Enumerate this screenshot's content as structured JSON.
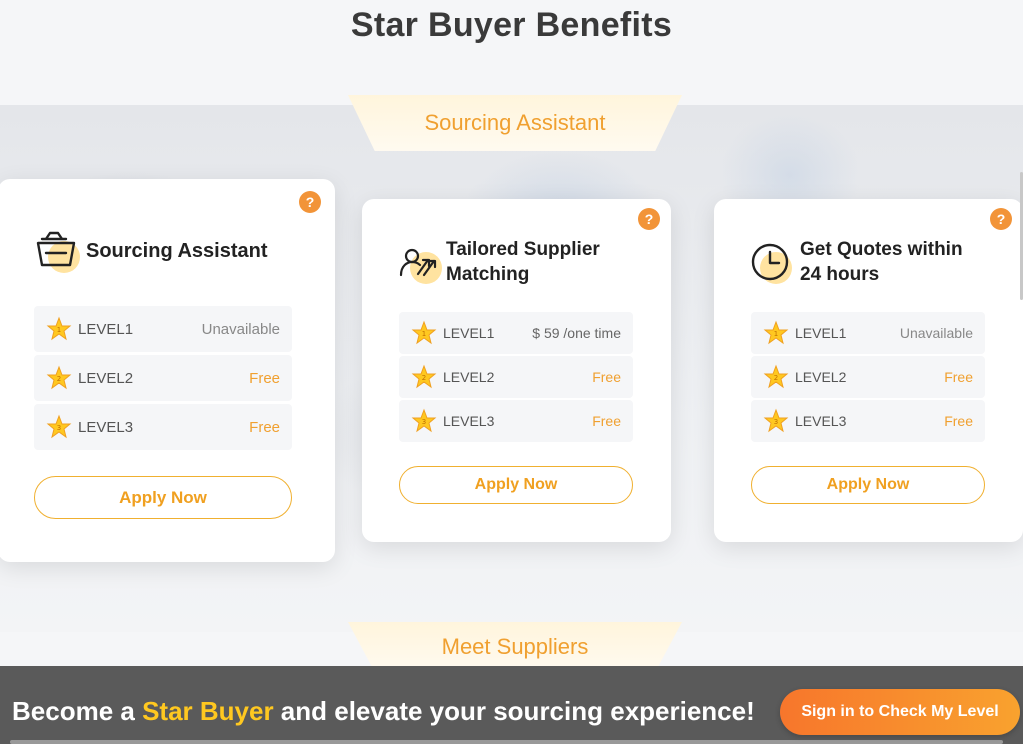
{
  "page": {
    "title": "Star Buyer Benefits"
  },
  "sections": {
    "top_label": "Sourcing Assistant",
    "bottom_label": "Meet Suppliers"
  },
  "cards": [
    {
      "title_line1": "Sourcing Assistant",
      "title_line2": "",
      "icon": "basket-icon",
      "help": "?",
      "levels": [
        {
          "name": "LEVEL1",
          "value": "Unavailable"
        },
        {
          "name": "LEVEL2",
          "value": "Free"
        },
        {
          "name": "LEVEL3",
          "value": "Free"
        }
      ],
      "button": "Apply Now"
    },
    {
      "title_line1": "Tailored Supplier",
      "title_line2": "Matching",
      "icon": "supplier-matching-icon",
      "help": "?",
      "levels": [
        {
          "name": "LEVEL1",
          "value": "$ 59 /one time"
        },
        {
          "name": "LEVEL2",
          "value": "Free"
        },
        {
          "name": "LEVEL3",
          "value": "Free"
        }
      ],
      "button": "Apply Now"
    },
    {
      "title_line1": "Get Quotes within",
      "title_line2": "24 hours",
      "icon": "clock-icon",
      "help": "?",
      "levels": [
        {
          "name": "LEVEL1",
          "value": "Unavailable"
        },
        {
          "name": "LEVEL2",
          "value": "Free"
        },
        {
          "name": "LEVEL3",
          "value": "Free"
        }
      ],
      "button": "Apply Now"
    }
  ],
  "promo": {
    "prefix": "Become a ",
    "highlight": "Star Buyer",
    "suffix": " and elevate your sourcing experience!",
    "signin": "Sign in to Check My Level"
  },
  "colors": {
    "accent": "#f0a030",
    "help": "#f29438",
    "signin_start": "#f7762c",
    "signin_end": "#f9a22e",
    "banner": "#5a5a5a"
  }
}
